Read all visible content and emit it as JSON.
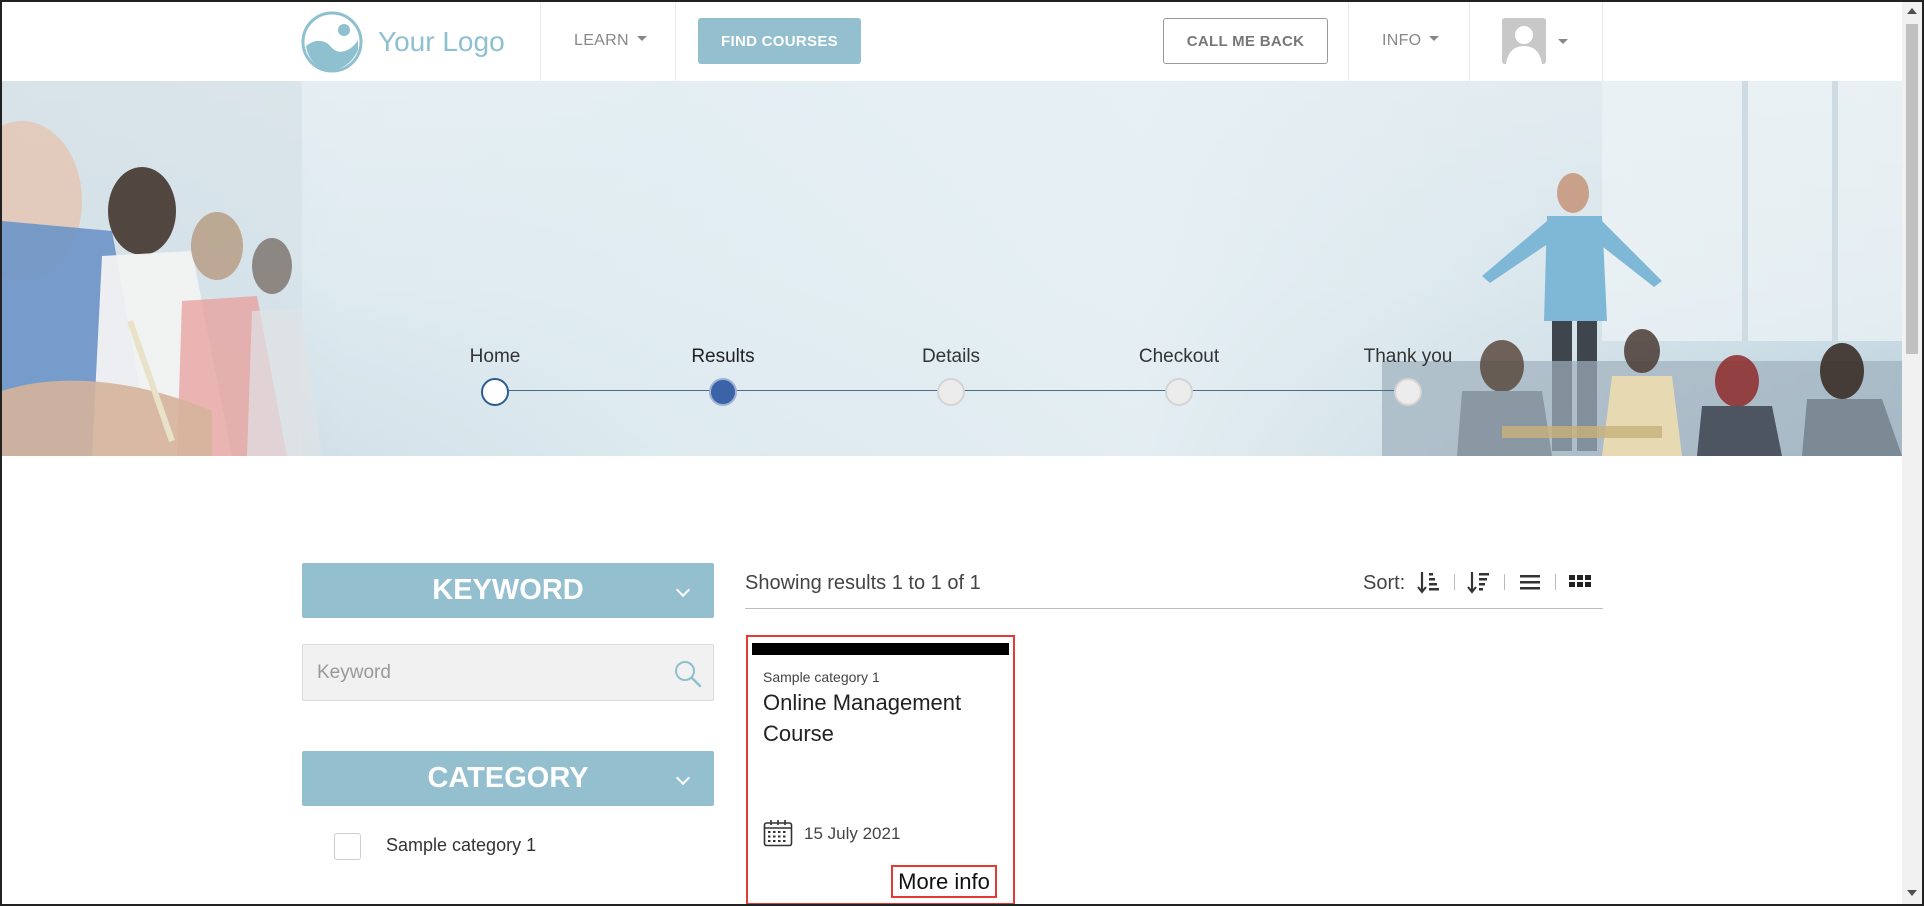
{
  "header": {
    "logo_text": "Your Logo",
    "nav_learn": "LEARN",
    "find_courses": "FIND COURSES",
    "call_me_back": "CALL ME BACK",
    "nav_info": "INFO"
  },
  "stepper": {
    "steps": [
      {
        "label": "Home",
        "state": "done"
      },
      {
        "label": "Results",
        "state": "active"
      },
      {
        "label": "Details",
        "state": "upcoming"
      },
      {
        "label": "Checkout",
        "state": "upcoming"
      },
      {
        "label": "Thank you",
        "state": "upcoming"
      }
    ]
  },
  "sidebar": {
    "keyword_heading": "KEYWORD",
    "keyword_placeholder": "Keyword",
    "category_heading": "CATEGORY",
    "categories": [
      {
        "label": "Sample category 1",
        "checked": false
      }
    ]
  },
  "results": {
    "count_text": "Showing results 1 to 1 of 1",
    "sort_label": "Sort:",
    "sort_icons": [
      "sort-ascending-icon",
      "sort-descending-icon",
      "list-view-icon",
      "grid-view-icon"
    ]
  },
  "courses": [
    {
      "category": "Sample category 1",
      "title": "Online Management Course",
      "date": "15 July 2021",
      "more_info": "More info"
    }
  ],
  "colors": {
    "accent": "#93bfcf",
    "step_active": "#3b63a8",
    "highlight_border": "#e53935"
  }
}
